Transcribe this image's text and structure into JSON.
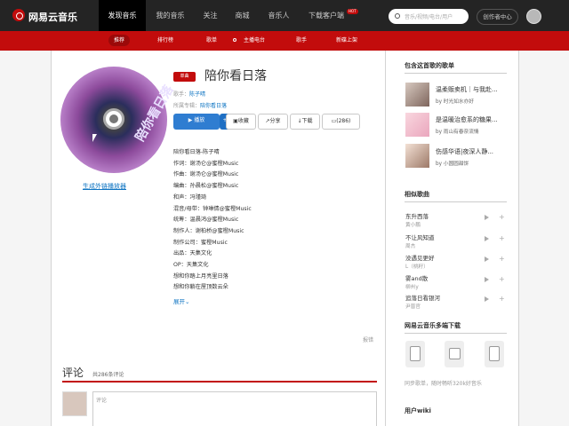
{
  "app": {
    "logo_text": "网易云音乐"
  },
  "top_nav": {
    "items": [
      "发现音乐",
      "我的音乐",
      "关注",
      "商城",
      "音乐人",
      "下载客户端"
    ],
    "hot_badge": "HOT"
  },
  "search": {
    "placeholder": "音乐/视频/电台/用户"
  },
  "creator_center": "创作者中心",
  "sub_nav": {
    "items": [
      "推荐",
      "排行榜",
      "歌单",
      "主播电台",
      "歌手",
      "新碟上架"
    ]
  },
  "song": {
    "tag": "单曲",
    "title": "陪你看日落",
    "disc_text": "陪你看日落",
    "singer_label": "歌手：",
    "singer": "陈子晴",
    "album_label": "所属专辑：",
    "album": "陪你看日落",
    "gen_link": "生成外链播放器"
  },
  "actions": {
    "play": "播放",
    "add": "+",
    "collect": "收藏",
    "share": "分享",
    "download": "下载",
    "comments": "(286)"
  },
  "lyrics": [
    "陪你看日落-陈子晴",
    "作词：谢汤仑@蜜橙Music",
    "作曲：谢汤仑@蜜橙Music",
    "编曲：孙晨松@蜜橙Music",
    "和声：冯瑾琦",
    "混音/母带：钟琳倩@蜜橙Music",
    "统筹：温晨鸿@蜜橙Music",
    "制作人：谢柏桥@蜜橙Music",
    "制作公司：蜜橙Music",
    "出品：天集文化",
    "OP：天集文化",
    "想和你踏上月亮里日落",
    "想和你躺在屋顶数云朵"
  ],
  "expand": "展开",
  "report": "报错",
  "comments": {
    "title": "评论",
    "count": "共286条评论",
    "placeholder": "评论"
  },
  "sidebar": {
    "playlists_title": "包含这首歌的歌单",
    "playlists": [
      {
        "name": "温柔贩卖机｜与我赴...",
        "by_prefix": "by",
        "by": "时光如水亦好"
      },
      {
        "name": "是温暖治愈系的糖果...",
        "by_prefix": "by",
        "by": "雨山有春奈流情"
      },
      {
        "name": "伤感华语|夜深人静...",
        "by_prefix": "by",
        "by": "小圆圆甜饼"
      }
    ],
    "similar_title": "相似歌曲",
    "similar": [
      {
        "name": "东升西落",
        "artist": "黄小鹏"
      },
      {
        "name": "不让风知道",
        "artist": "周杰"
      },
      {
        "name": "没遇见更好",
        "artist": "L（桃籽）"
      },
      {
        "name": "雾and散",
        "artist": "柳州y"
      },
      {
        "name": "追落日看银河",
        "artist": "尹晋官"
      }
    ],
    "download_title": "网易云音乐多端下载",
    "download_note": "同步歌单，随时畅听320k好音乐",
    "wiki_title": "用户wiki"
  },
  "colors": {
    "brand_red": "#c20c0c",
    "top_bg": "#242424",
    "link_blue": "#0c73c2"
  }
}
